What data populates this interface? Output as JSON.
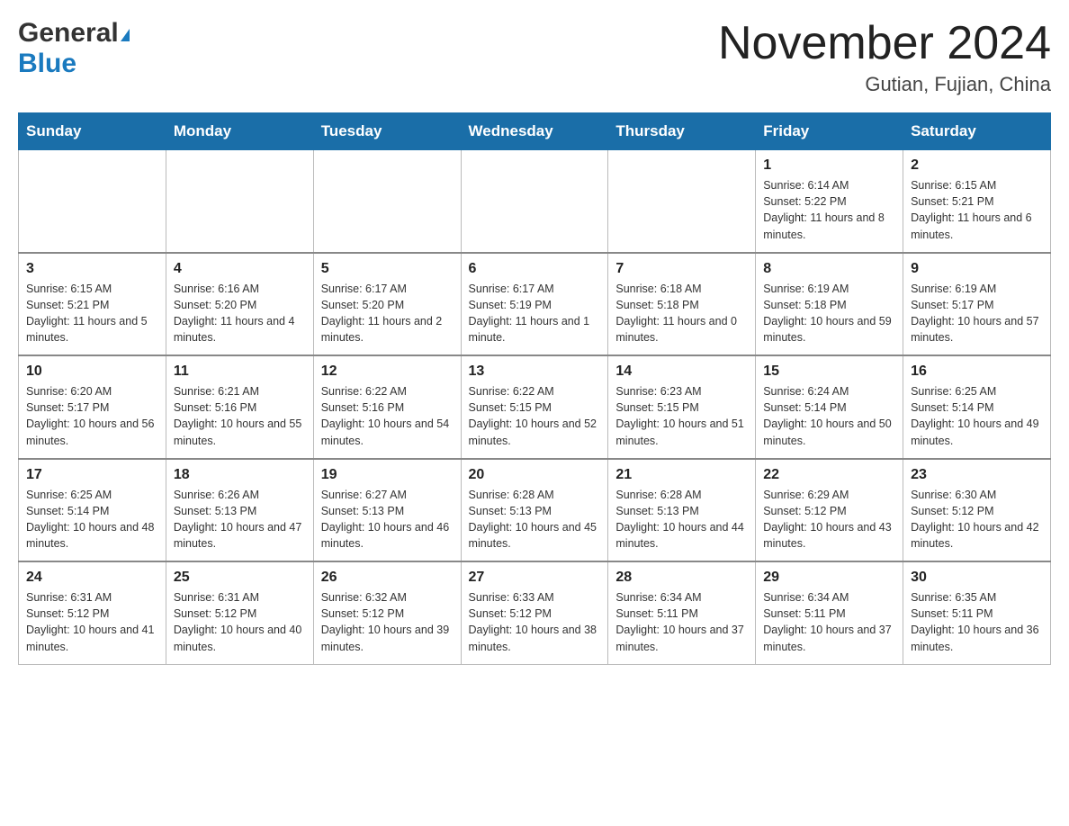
{
  "header": {
    "logo_general": "General",
    "logo_blue": "Blue",
    "month_title": "November 2024",
    "location": "Gutian, Fujian, China"
  },
  "weekdays": [
    "Sunday",
    "Monday",
    "Tuesday",
    "Wednesday",
    "Thursday",
    "Friday",
    "Saturday"
  ],
  "weeks": [
    [
      {
        "day": "",
        "info": ""
      },
      {
        "day": "",
        "info": ""
      },
      {
        "day": "",
        "info": ""
      },
      {
        "day": "",
        "info": ""
      },
      {
        "day": "",
        "info": ""
      },
      {
        "day": "1",
        "info": "Sunrise: 6:14 AM\nSunset: 5:22 PM\nDaylight: 11 hours and 8 minutes."
      },
      {
        "day": "2",
        "info": "Sunrise: 6:15 AM\nSunset: 5:21 PM\nDaylight: 11 hours and 6 minutes."
      }
    ],
    [
      {
        "day": "3",
        "info": "Sunrise: 6:15 AM\nSunset: 5:21 PM\nDaylight: 11 hours and 5 minutes."
      },
      {
        "day": "4",
        "info": "Sunrise: 6:16 AM\nSunset: 5:20 PM\nDaylight: 11 hours and 4 minutes."
      },
      {
        "day": "5",
        "info": "Sunrise: 6:17 AM\nSunset: 5:20 PM\nDaylight: 11 hours and 2 minutes."
      },
      {
        "day": "6",
        "info": "Sunrise: 6:17 AM\nSunset: 5:19 PM\nDaylight: 11 hours and 1 minute."
      },
      {
        "day": "7",
        "info": "Sunrise: 6:18 AM\nSunset: 5:18 PM\nDaylight: 11 hours and 0 minutes."
      },
      {
        "day": "8",
        "info": "Sunrise: 6:19 AM\nSunset: 5:18 PM\nDaylight: 10 hours and 59 minutes."
      },
      {
        "day": "9",
        "info": "Sunrise: 6:19 AM\nSunset: 5:17 PM\nDaylight: 10 hours and 57 minutes."
      }
    ],
    [
      {
        "day": "10",
        "info": "Sunrise: 6:20 AM\nSunset: 5:17 PM\nDaylight: 10 hours and 56 minutes."
      },
      {
        "day": "11",
        "info": "Sunrise: 6:21 AM\nSunset: 5:16 PM\nDaylight: 10 hours and 55 minutes."
      },
      {
        "day": "12",
        "info": "Sunrise: 6:22 AM\nSunset: 5:16 PM\nDaylight: 10 hours and 54 minutes."
      },
      {
        "day": "13",
        "info": "Sunrise: 6:22 AM\nSunset: 5:15 PM\nDaylight: 10 hours and 52 minutes."
      },
      {
        "day": "14",
        "info": "Sunrise: 6:23 AM\nSunset: 5:15 PM\nDaylight: 10 hours and 51 minutes."
      },
      {
        "day": "15",
        "info": "Sunrise: 6:24 AM\nSunset: 5:14 PM\nDaylight: 10 hours and 50 minutes."
      },
      {
        "day": "16",
        "info": "Sunrise: 6:25 AM\nSunset: 5:14 PM\nDaylight: 10 hours and 49 minutes."
      }
    ],
    [
      {
        "day": "17",
        "info": "Sunrise: 6:25 AM\nSunset: 5:14 PM\nDaylight: 10 hours and 48 minutes."
      },
      {
        "day": "18",
        "info": "Sunrise: 6:26 AM\nSunset: 5:13 PM\nDaylight: 10 hours and 47 minutes."
      },
      {
        "day": "19",
        "info": "Sunrise: 6:27 AM\nSunset: 5:13 PM\nDaylight: 10 hours and 46 minutes."
      },
      {
        "day": "20",
        "info": "Sunrise: 6:28 AM\nSunset: 5:13 PM\nDaylight: 10 hours and 45 minutes."
      },
      {
        "day": "21",
        "info": "Sunrise: 6:28 AM\nSunset: 5:13 PM\nDaylight: 10 hours and 44 minutes."
      },
      {
        "day": "22",
        "info": "Sunrise: 6:29 AM\nSunset: 5:12 PM\nDaylight: 10 hours and 43 minutes."
      },
      {
        "day": "23",
        "info": "Sunrise: 6:30 AM\nSunset: 5:12 PM\nDaylight: 10 hours and 42 minutes."
      }
    ],
    [
      {
        "day": "24",
        "info": "Sunrise: 6:31 AM\nSunset: 5:12 PM\nDaylight: 10 hours and 41 minutes."
      },
      {
        "day": "25",
        "info": "Sunrise: 6:31 AM\nSunset: 5:12 PM\nDaylight: 10 hours and 40 minutes."
      },
      {
        "day": "26",
        "info": "Sunrise: 6:32 AM\nSunset: 5:12 PM\nDaylight: 10 hours and 39 minutes."
      },
      {
        "day": "27",
        "info": "Sunrise: 6:33 AM\nSunset: 5:12 PM\nDaylight: 10 hours and 38 minutes."
      },
      {
        "day": "28",
        "info": "Sunrise: 6:34 AM\nSunset: 5:11 PM\nDaylight: 10 hours and 37 minutes."
      },
      {
        "day": "29",
        "info": "Sunrise: 6:34 AM\nSunset: 5:11 PM\nDaylight: 10 hours and 37 minutes."
      },
      {
        "day": "30",
        "info": "Sunrise: 6:35 AM\nSunset: 5:11 PM\nDaylight: 10 hours and 36 minutes."
      }
    ]
  ]
}
